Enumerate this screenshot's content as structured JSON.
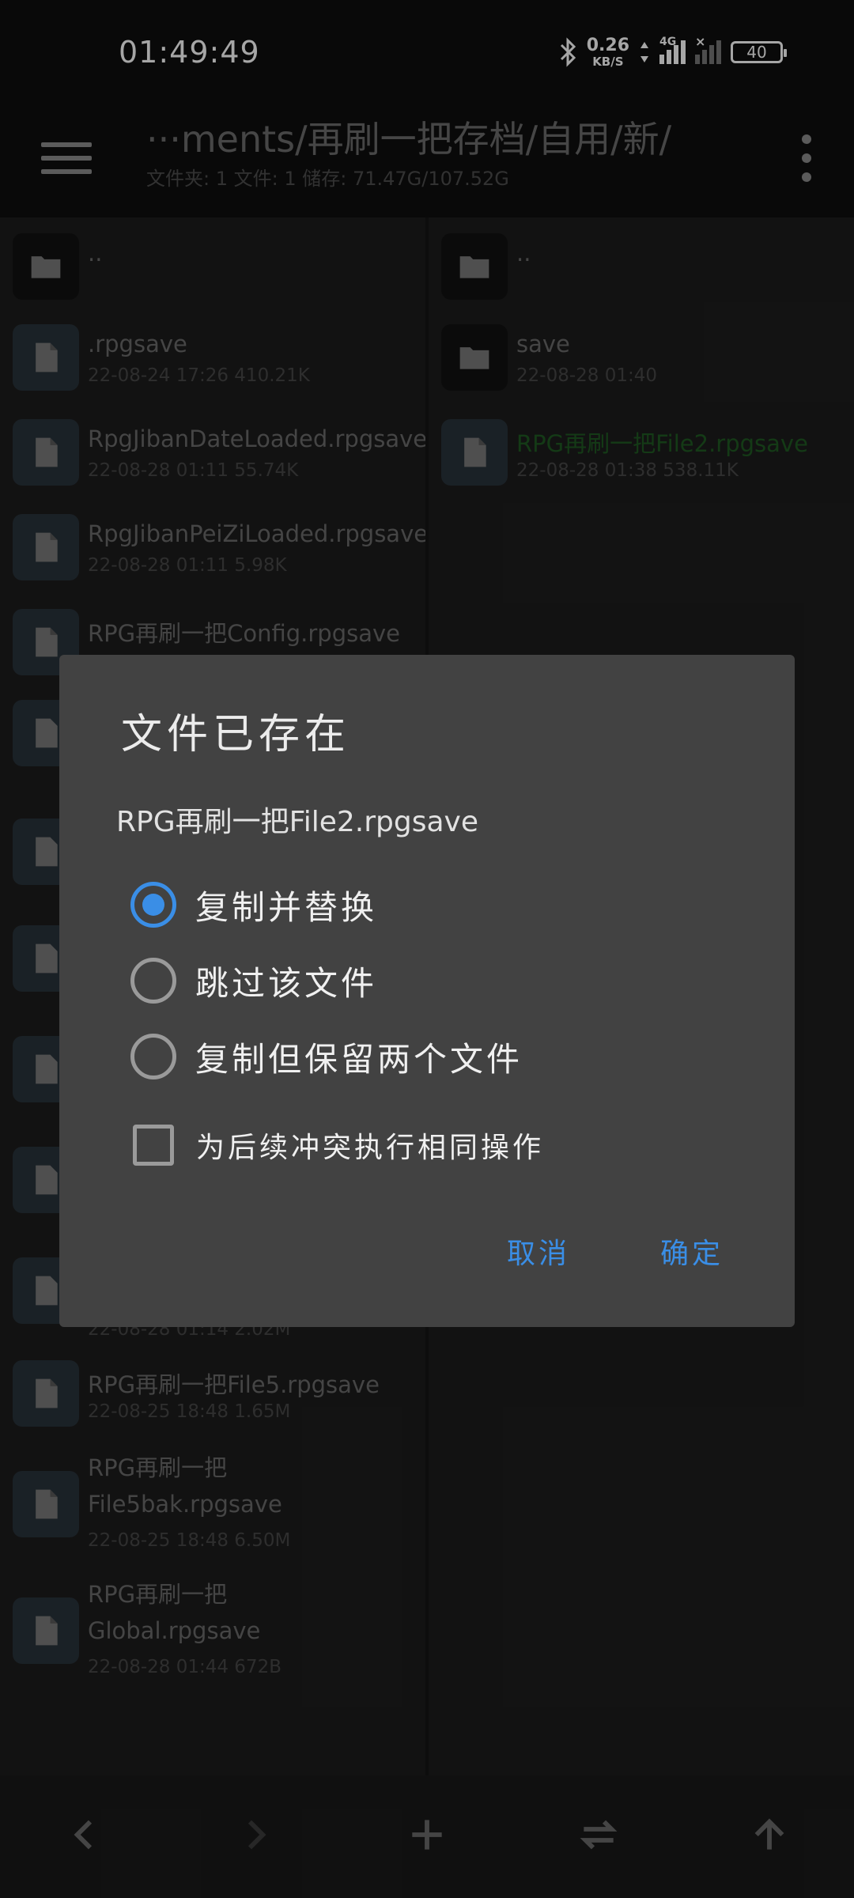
{
  "status": {
    "time": "01:49:49",
    "speed_value": "0.26",
    "speed_unit": "KB/S",
    "network": "4G",
    "battery": "40"
  },
  "toolbar": {
    "path": "···ments/再刷一把存档/自用/新/",
    "info": "文件夹: 1   文件: 1   储存: 71.47G/107.52G"
  },
  "left_pane": {
    "items": [
      {
        "type": "folder",
        "name": "..",
        "meta": ""
      },
      {
        "type": "file",
        "name": ".rpgsave",
        "meta": "22-08-24 17:26  410.21K"
      },
      {
        "type": "file",
        "name": "RpgJibanDateLoaded.rpgsave",
        "meta": "22-08-28 01:11  55.74K"
      },
      {
        "type": "file",
        "name": "RpgJibanPeiZiLoaded.rpgsave",
        "meta": "22-08-28 01:11  5.98K"
      },
      {
        "type": "file",
        "name": "RPG再刷一把Config.rpgsave",
        "meta": ""
      },
      {
        "type": "file",
        "name": "",
        "meta": "22-08-28 01:14  2.02M"
      },
      {
        "type": "file",
        "name": "RPG再刷一把File5.rpgsave",
        "meta": "22-08-25 18:48  1.65M"
      },
      {
        "type": "file",
        "name": "RPG再刷一把",
        "name2": "File5bak.rpgsave",
        "meta": "22-08-25 18:48  6.50M"
      },
      {
        "type": "file",
        "name": "RPG再刷一把",
        "name2": "Global.rpgsave",
        "meta": "22-08-28 01:44  672B"
      }
    ]
  },
  "right_pane": {
    "items": [
      {
        "type": "folder",
        "name": "..",
        "meta": ""
      },
      {
        "type": "folder",
        "name": "save",
        "meta": "22-08-28 01:40"
      },
      {
        "type": "file",
        "name": "RPG再刷一把File2.rpgsave",
        "meta": "22-08-28 01:38  538.11K"
      }
    ]
  },
  "dialog": {
    "title": "文件已存在",
    "filename": "RPG再刷一把File2.rpgsave",
    "options": [
      "复制并替换",
      "跳过该文件",
      "复制但保留两个文件"
    ],
    "selected_option": 0,
    "apply_all_label": "为后续冲突执行相同操作",
    "apply_all_checked": false,
    "cancel_label": "取消",
    "confirm_label": "确定"
  },
  "colors": {
    "accent": "#3a8ee6",
    "dialog_bg": "#424242",
    "highlight_file": "#1f5a22"
  }
}
